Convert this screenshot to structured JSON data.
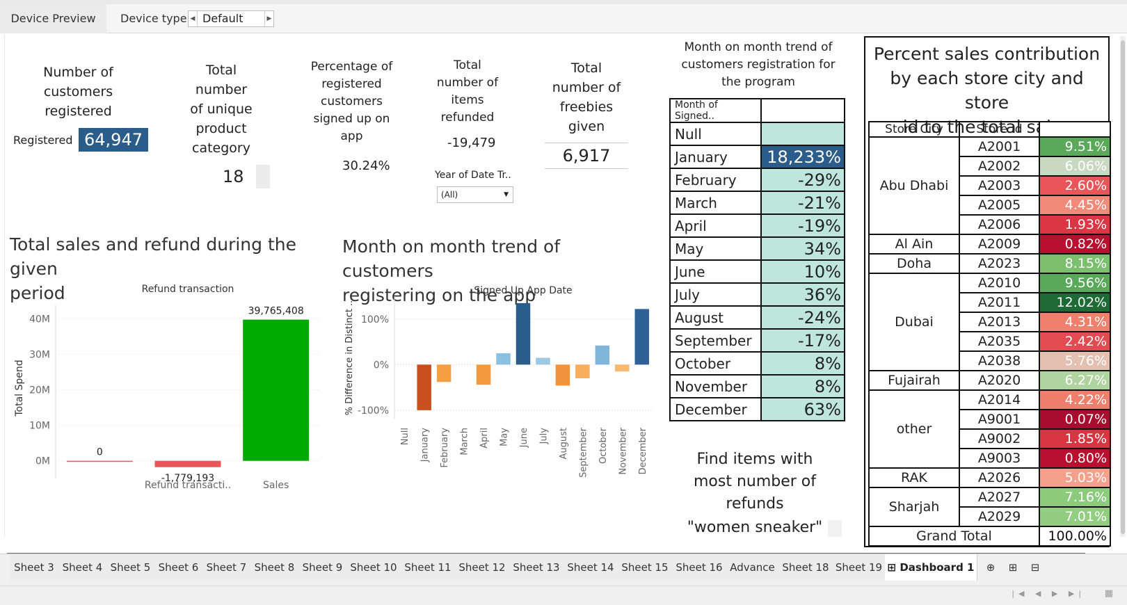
{
  "topbar": {
    "preview_tab": "Device Preview",
    "device_type_label": "Device type",
    "device_type_value": "Default"
  },
  "kpis": {
    "customers_registered": {
      "title_lines": [
        "Number of",
        "customers",
        "registered"
      ],
      "label": "Registered",
      "value": "64,947"
    },
    "unique_category": {
      "title_lines": [
        "Total",
        "number",
        "of unique",
        "product",
        "category"
      ],
      "value": "18"
    },
    "pct_signed_up": {
      "title_lines": [
        "Percentage of",
        "registered",
        "customers",
        "signed up on",
        "app"
      ],
      "value": "30.24%"
    },
    "items_refunded": {
      "title_lines": [
        "Total",
        "number of",
        "items",
        "refunded"
      ],
      "value": "-19,479",
      "filter_label": "Year of Date Tr..",
      "filter_value": "(All)"
    },
    "freebies": {
      "title_lines": [
        "Total",
        "number of",
        "freebies",
        "given"
      ],
      "value": "6,917"
    }
  },
  "month_trend_title_lines": [
    "Month on month trend of",
    "customers registration for",
    "the program"
  ],
  "month_table": {
    "header": "Month of Signed..",
    "rows": [
      {
        "month": "Null",
        "value": ""
      },
      {
        "month": "January",
        "value": "18,233%"
      },
      {
        "month": "February",
        "value": "-29%"
      },
      {
        "month": "March",
        "value": "-21%"
      },
      {
        "month": "April",
        "value": "-19%"
      },
      {
        "month": "May",
        "value": "34%"
      },
      {
        "month": "June",
        "value": "10%"
      },
      {
        "month": "July",
        "value": "36%"
      },
      {
        "month": "August",
        "value": "-24%"
      },
      {
        "month": "September",
        "value": "-17%"
      },
      {
        "month": "October",
        "value": "8%"
      },
      {
        "month": "November",
        "value": "8%"
      },
      {
        "month": "December",
        "value": "63%"
      }
    ]
  },
  "find_items": {
    "lines": [
      "Find items with",
      "most number of",
      "refunds"
    ],
    "answer": "\"women sneaker\""
  },
  "store_section": {
    "title_lines": [
      "Percent sales contribution",
      "by each store city and store",
      "id to the total sales"
    ],
    "headers": [
      "Store City",
      "Store Id"
    ],
    "groups": [
      {
        "city": "Abu Dhabi",
        "rows": [
          [
            "A2001",
            "9.51%",
            "#5aa95a"
          ],
          [
            "A2002",
            "6.06%",
            "#c9d8c0"
          ],
          [
            "A2003",
            "2.60%",
            "#e8565a"
          ],
          [
            "A2005",
            "4.45%",
            "#f18a78"
          ],
          [
            "A2006",
            "1.93%",
            "#dc3644"
          ]
        ]
      },
      {
        "city": "Al Ain",
        "rows": [
          [
            "A2009",
            "0.82%",
            "#b8102e"
          ]
        ]
      },
      {
        "city": "Doha",
        "rows": [
          [
            "A2023",
            "8.15%",
            "#7cbf6e"
          ]
        ]
      },
      {
        "city": "Dubai",
        "rows": [
          [
            "A2010",
            "9.56%",
            "#5aa95a"
          ],
          [
            "A2011",
            "12.02%",
            "#1e6b35"
          ],
          [
            "A2013",
            "4.31%",
            "#f0806e"
          ],
          [
            "A2035",
            "2.42%",
            "#e34a52"
          ],
          [
            "A2038",
            "5.76%",
            "#e3c0b0"
          ]
        ]
      },
      {
        "city": "Fujairah",
        "rows": [
          [
            "A2020",
            "6.27%",
            "#b0d4a0"
          ]
        ]
      },
      {
        "city": "other",
        "rows": [
          [
            "A2014",
            "4.22%",
            "#ef7e6c"
          ],
          [
            "A9001",
            "0.07%",
            "#a80c2e"
          ],
          [
            "A9002",
            "1.85%",
            "#d93442"
          ],
          [
            "A9003",
            "0.80%",
            "#b8102e"
          ]
        ]
      },
      {
        "city": "RAK",
        "rows": [
          [
            "A2026",
            "5.03%",
            "#f5a08c"
          ]
        ]
      },
      {
        "city": "Sharjah",
        "rows": [
          [
            "A2027",
            "7.16%",
            "#8cca7c"
          ],
          [
            "A2029",
            "7.01%",
            "#92cd82"
          ]
        ]
      }
    ],
    "grand_total_label": "Grand Total",
    "grand_total_value": "100.00%"
  },
  "sales_section": {
    "title_lines": [
      "Total sales and refund during the given",
      "period"
    ]
  },
  "signup_section": {
    "title_lines": [
      "Month on month trend of customers",
      "registering on the app"
    ]
  },
  "chart_data": [
    {
      "type": "bar",
      "title": "Refund transaction",
      "ylabel": "Total Spend",
      "categories": [
        "",
        "Refund transacti..",
        "Sales"
      ],
      "values": [
        0,
        -1779193,
        39765408
      ],
      "data_labels": [
        "0",
        "-1,779,193",
        "39,765,408"
      ],
      "colors": [
        "#e8565a",
        "#e8565a",
        "#00aa00"
      ],
      "yticks": [
        "0M",
        "10M",
        "20M",
        "30M",
        "40M"
      ],
      "ylim": [
        -3000000,
        44000000
      ]
    },
    {
      "type": "bar",
      "title": "Signed Up App Date",
      "ylabel": "% Difference in Distinct ..",
      "categories": [
        "Null",
        "January",
        "February",
        "March",
        "April",
        "May",
        "June",
        "July",
        "August",
        "September",
        "October",
        "November",
        "December"
      ],
      "values": [
        0,
        -100,
        -38,
        0,
        -44,
        25,
        135,
        15,
        -46,
        -30,
        42,
        -15,
        122
      ],
      "colors": [
        "#ccc",
        "#c9501e",
        "#f4a040",
        "#ccc",
        "#f49a3c",
        "#8cc0e0",
        "#2b5d8a",
        "#9cc8e4",
        "#f1933a",
        "#f6ae5c",
        "#7fb6da",
        "#f8b870",
        "#2f6196"
      ],
      "yticks": [
        "-100%",
        "0%",
        "100%"
      ],
      "ylim": [
        -120,
        150
      ]
    }
  ],
  "tabs": [
    "Sheet 3",
    "Sheet 4",
    "Sheet 5",
    "Sheet 6",
    "Sheet 7",
    "Sheet 8",
    "Sheet 9",
    "Sheet 10",
    "Sheet 11",
    "Sheet 12",
    "Sheet 13",
    "Sheet 14",
    "Sheet 15",
    "Sheet 16",
    "Advance",
    "Sheet 18",
    "Sheet 19",
    "Dashboard 1"
  ]
}
